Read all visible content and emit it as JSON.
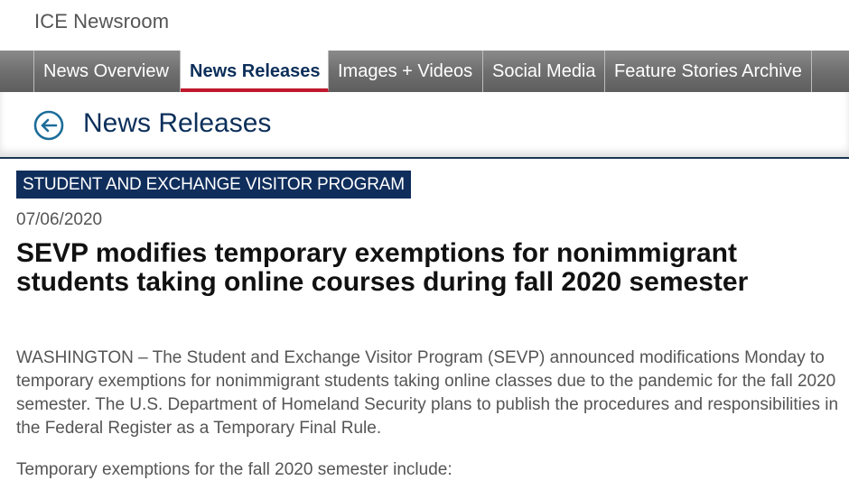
{
  "site": {
    "title": "ICE Newsroom"
  },
  "nav": {
    "tabs": [
      {
        "label": "News Overview",
        "active": false
      },
      {
        "label": "News Releases",
        "active": true
      },
      {
        "label": "Images + Videos",
        "active": false
      },
      {
        "label": "Social Media",
        "active": false
      },
      {
        "label": "Feature Stories Archive",
        "active": false
      }
    ]
  },
  "page": {
    "back_icon": "circle-arrow-left-icon",
    "title": "News Releases"
  },
  "article": {
    "category": "STUDENT AND EXCHANGE VISITOR PROGRAM",
    "date": "07/06/2020",
    "headline": "SEVP modifies temporary exemptions for nonimmigrant students taking online courses during fall 2020 semester",
    "paragraphs": [
      "WASHINGTON – The Student and Exchange Visitor Program (SEVP) announced modifications Monday to temporary exemptions for nonimmigrant students taking online classes due to the pandemic for the fall 2020 semester. The U.S. Department of Homeland Security plans to publish the procedures and responsibilities in the Federal Register as a Temporary Final Rule.",
      "Temporary exemptions for the fall 2020 semester include:"
    ]
  },
  "colors": {
    "navy": "#0c2f5a",
    "badge": "#102e5c",
    "active_underline": "#c0182c",
    "nav_gray": "#6f6f6f",
    "body_text": "#555555"
  }
}
